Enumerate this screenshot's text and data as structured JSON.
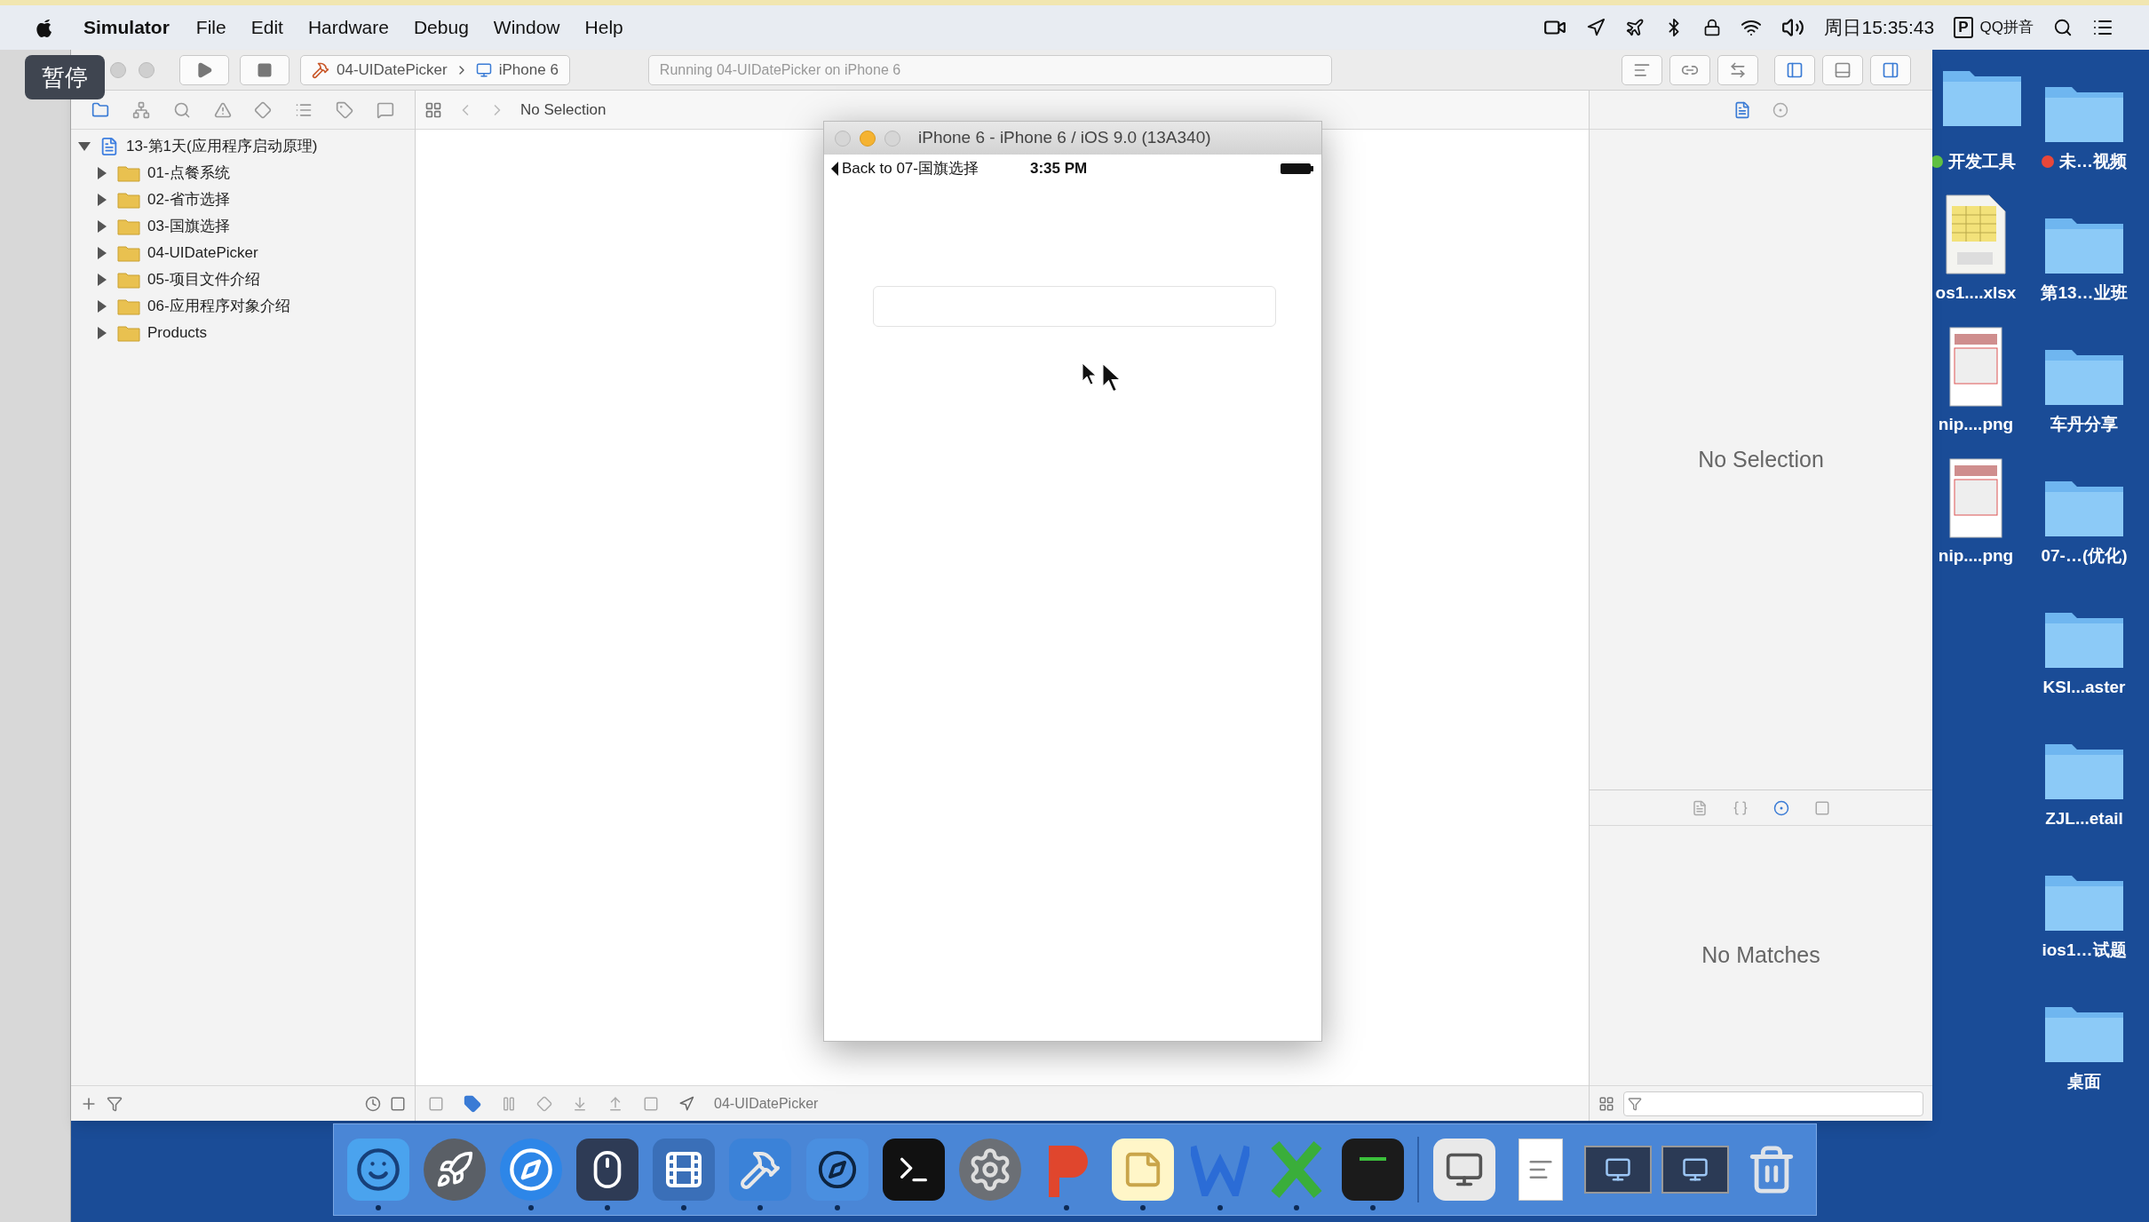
{
  "menu_bar": {
    "app": "Simulator",
    "items": [
      "File",
      "Edit",
      "Hardware",
      "Debug",
      "Window",
      "Help"
    ],
    "clock": "周日15:35:43",
    "input_method_badge": "P",
    "input_method": "QQ拼音"
  },
  "pause_badge": "暂停",
  "xcode": {
    "scheme": "04-UIDatePicker",
    "device": "iPhone 6",
    "activity": "Running 04-UIDatePicker on iPhone 6",
    "navigator_tabs": [
      {
        "kind": "folder",
        "selected": true
      },
      {
        "kind": "hierarchy",
        "selected": false
      },
      {
        "kind": "search",
        "selected": false
      },
      {
        "kind": "warning",
        "selected": false
      },
      {
        "kind": "diamond",
        "selected": false
      },
      {
        "kind": "list",
        "selected": false
      },
      {
        "kind": "tag",
        "selected": false
      },
      {
        "kind": "comment",
        "selected": false
      }
    ],
    "tree": [
      {
        "label": "13-第1天(应用程序启动原理)",
        "kind": "project",
        "expanded": true,
        "children": [
          {
            "label": "01-点餐系统",
            "kind": "folder",
            "expanded": false
          },
          {
            "label": "02-省市选择",
            "kind": "folder",
            "expanded": false
          },
          {
            "label": "03-国旗选择",
            "kind": "folder",
            "expanded": false
          },
          {
            "label": "04-UIDatePicker",
            "kind": "folder",
            "expanded": false
          },
          {
            "label": "05-项目文件介绍",
            "kind": "folder",
            "expanded": false
          },
          {
            "label": "06-应用程序对象介绍",
            "kind": "folder",
            "expanded": false
          },
          {
            "label": "Products",
            "kind": "folder",
            "expanded": false
          }
        ]
      }
    ],
    "jump_bar": "No Selection",
    "debug_target": "04-UIDatePicker",
    "inspector_empty": "No Selection",
    "library_tabs": [
      {
        "kind": "file",
        "selected": false
      },
      {
        "kind": "braces",
        "selected": false
      },
      {
        "kind": "circle",
        "selected": true
      },
      {
        "kind": "media",
        "selected": false
      }
    ],
    "library_empty": "No Matches"
  },
  "simulator": {
    "title": "iPhone 6 - iPhone 6 / iOS 9.0 (13A340)",
    "back": "Back to 07-国旗选择",
    "time": "3:35 PM"
  },
  "desktop_left_column": [
    {
      "label": "os1....xlsx",
      "kind": "spreadsheet"
    },
    {
      "label": "nip....png",
      "kind": "image"
    },
    {
      "label": "nip....png",
      "kind": "image"
    }
  ],
  "desktop_right_column": [
    {
      "label": "未…视频",
      "kind": "folder",
      "color": "#e8473a"
    },
    {
      "label": "第13…业班",
      "kind": "folder"
    },
    {
      "label": "车丹分享",
      "kind": "folder"
    },
    {
      "label": "07-…(优化)",
      "kind": "folder"
    },
    {
      "label": "KSl...aster",
      "kind": "folder"
    },
    {
      "label": "ZJL...etail",
      "kind": "folder"
    },
    {
      "label": "ios1…试题",
      "kind": "folder"
    },
    {
      "label": "桌面",
      "kind": "folder"
    }
  ],
  "desktop_top_left": {
    "label": "开发工具",
    "color": "#5fc041"
  },
  "dock": [
    {
      "kind": "finder",
      "running": true
    },
    {
      "kind": "rocket",
      "running": false
    },
    {
      "kind": "compass",
      "running": true
    },
    {
      "kind": "mouse",
      "running": true
    },
    {
      "kind": "film",
      "running": true
    },
    {
      "kind": "hammer",
      "running": true
    },
    {
      "kind": "blueprint",
      "running": true
    },
    {
      "kind": "terminal",
      "running": false
    },
    {
      "kind": "gear",
      "running": false
    },
    {
      "kind": "redapp",
      "running": true
    },
    {
      "kind": "notes",
      "running": true
    },
    {
      "kind": "blueapp",
      "running": true
    },
    {
      "kind": "greenapp",
      "running": true
    },
    {
      "kind": "console",
      "running": true
    },
    {
      "kind": "separator"
    },
    {
      "kind": "preview",
      "running": false
    },
    {
      "kind": "textfile",
      "running": false
    },
    {
      "kind": "screen",
      "running": false
    },
    {
      "kind": "screen",
      "running": false
    },
    {
      "kind": "trash",
      "running": false
    }
  ]
}
